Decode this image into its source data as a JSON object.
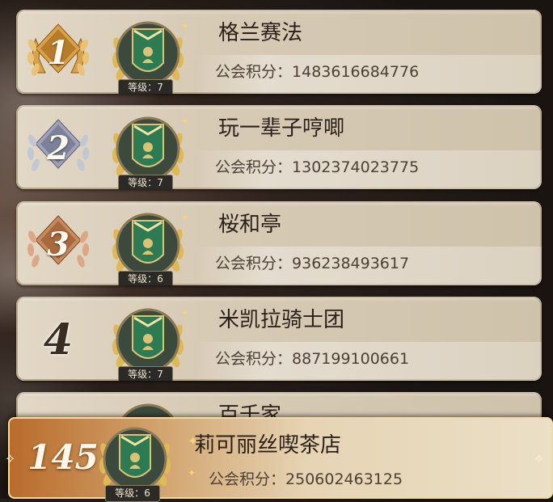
{
  "level_prefix": "等级：",
  "points_label": "公会积分：",
  "medals": {
    "1": {
      "fill": "#d9a24a",
      "stroke": "#8a5a18"
    },
    "2": {
      "fill": "#9ea3b8",
      "stroke": "#5d6078"
    },
    "3": {
      "fill": "#c98a5e",
      "stroke": "#7a4a2a"
    }
  },
  "rows": [
    {
      "rank": "1",
      "name": "格兰赛法",
      "points": "1483616684776",
      "level": "7",
      "medal": true
    },
    {
      "rank": "2",
      "name": "玩一辈子哼唧",
      "points": "1302374023775",
      "level": "7",
      "medal": true
    },
    {
      "rank": "3",
      "name": "桜和亭",
      "points": "936238493617",
      "level": "6",
      "medal": true
    },
    {
      "rank": "4",
      "name": "米凯拉骑士团",
      "points": "887199100661",
      "level": "7",
      "medal": false
    },
    {
      "rank": "",
      "name": "百千家",
      "points": "",
      "level": "",
      "medal": false
    }
  ],
  "my_guild": {
    "rank": "145",
    "name": "莉可丽丝喫茶店",
    "points": "250602463125",
    "level": "6"
  }
}
